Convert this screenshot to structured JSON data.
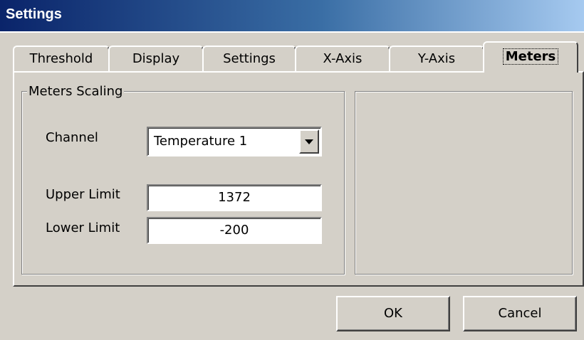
{
  "window": {
    "title": "Settings"
  },
  "tabs": [
    {
      "label": "Threshold"
    },
    {
      "label": "Display"
    },
    {
      "label": "Settings"
    },
    {
      "label": "X-Axis"
    },
    {
      "label": "Y-Axis"
    },
    {
      "label": "Meters",
      "active": true
    }
  ],
  "meters_scaling": {
    "legend": "Meters Scaling",
    "channel_label": "Channel",
    "channel_value": "Temperature 1",
    "upper_label": "Upper Limit",
    "upper_value": "1372",
    "lower_label": "Lower Limit",
    "lower_value": "-200"
  },
  "buttons": {
    "ok": "OK",
    "cancel": "Cancel"
  },
  "colors": {
    "titlebar_start": "#0a246a",
    "titlebar_end": "#a6caf0",
    "face": "#d4d0c8"
  },
  "icons": {
    "combo_arrow": "chevron-down-icon"
  }
}
